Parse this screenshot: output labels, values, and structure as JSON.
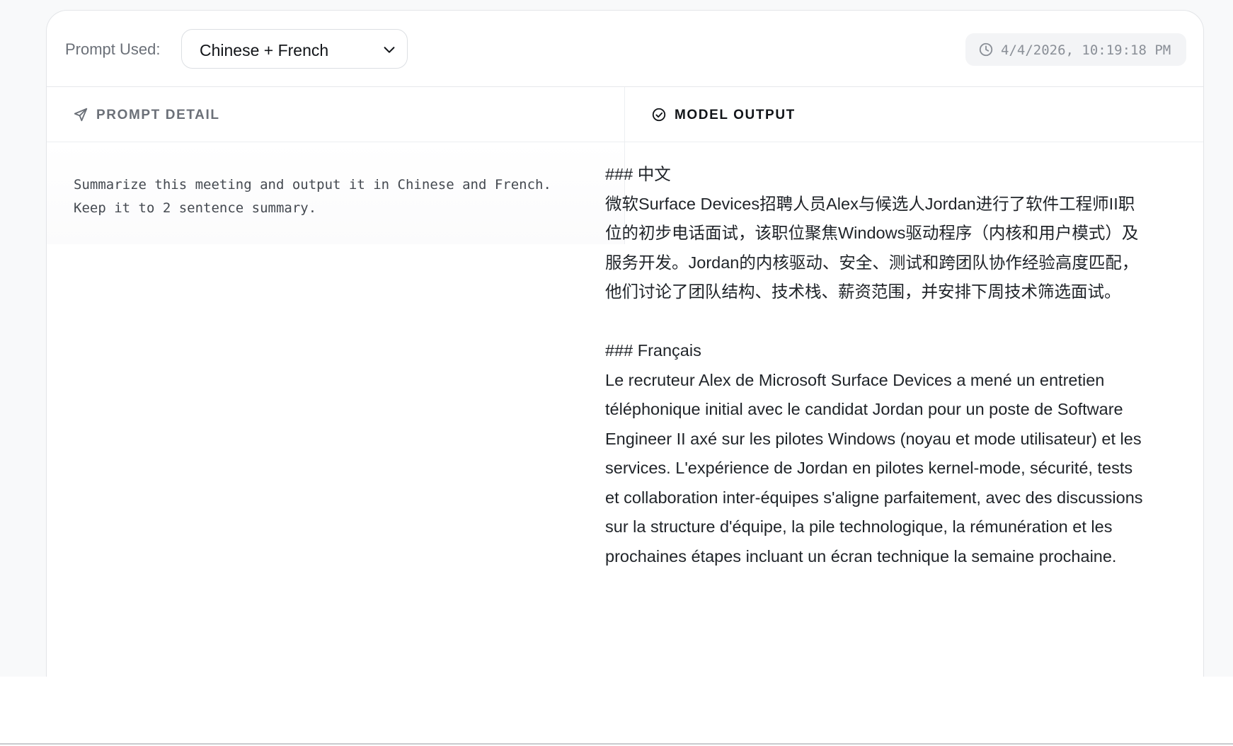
{
  "toolbar": {
    "prompt_label": "Prompt Used:",
    "prompt_select_value": "Chinese + French",
    "timestamp": "4/4/2026, 10:19:18 PM"
  },
  "prompt_panel": {
    "title": "PROMPT DETAIL",
    "icon": "send-icon",
    "text": "Summarize this meeting and output it in Chinese and French.\nKeep it to 2 sentence summary."
  },
  "output_panel": {
    "title": "MODEL OUTPUT",
    "icon": "check-circle-icon",
    "zh_heading": "### 中文",
    "zh_text": "微软Surface Devices招聘人员Alex与候选人Jordan进行了软件工程师II职位的初步电话面试，该职位聚焦Windows驱动程序（内核和用户模式）及服务开发。Jordan的内核驱动、安全、测试和跨团队协作经验高度匹配，他们讨论了团队结构、技术栈、薪资范围，并安排下周技术筛选面试。",
    "fr_heading": "### Français",
    "fr_text": "Le recruteur Alex de Microsoft Surface Devices a mené un entretien téléphonique initial avec le candidat Jordan pour un poste de Software Engineer II axé sur les pilotes Windows (noyau et mode utilisateur) et les services. L'expérience de Jordan en pilotes kernel-mode, sécurité, tests et collaboration inter-équipes s'aligne parfaitement, avec des discussions sur la structure d'équipe, la pile technologique, la rémunération et les prochaines étapes incluant un écran technique la semaine prochaine."
  },
  "colors": {
    "page_background": "#f8f9fa",
    "card_border": "#e3e5e8",
    "muted_text": "#6b7078",
    "timestamp_bg": "#f3f4f6"
  }
}
